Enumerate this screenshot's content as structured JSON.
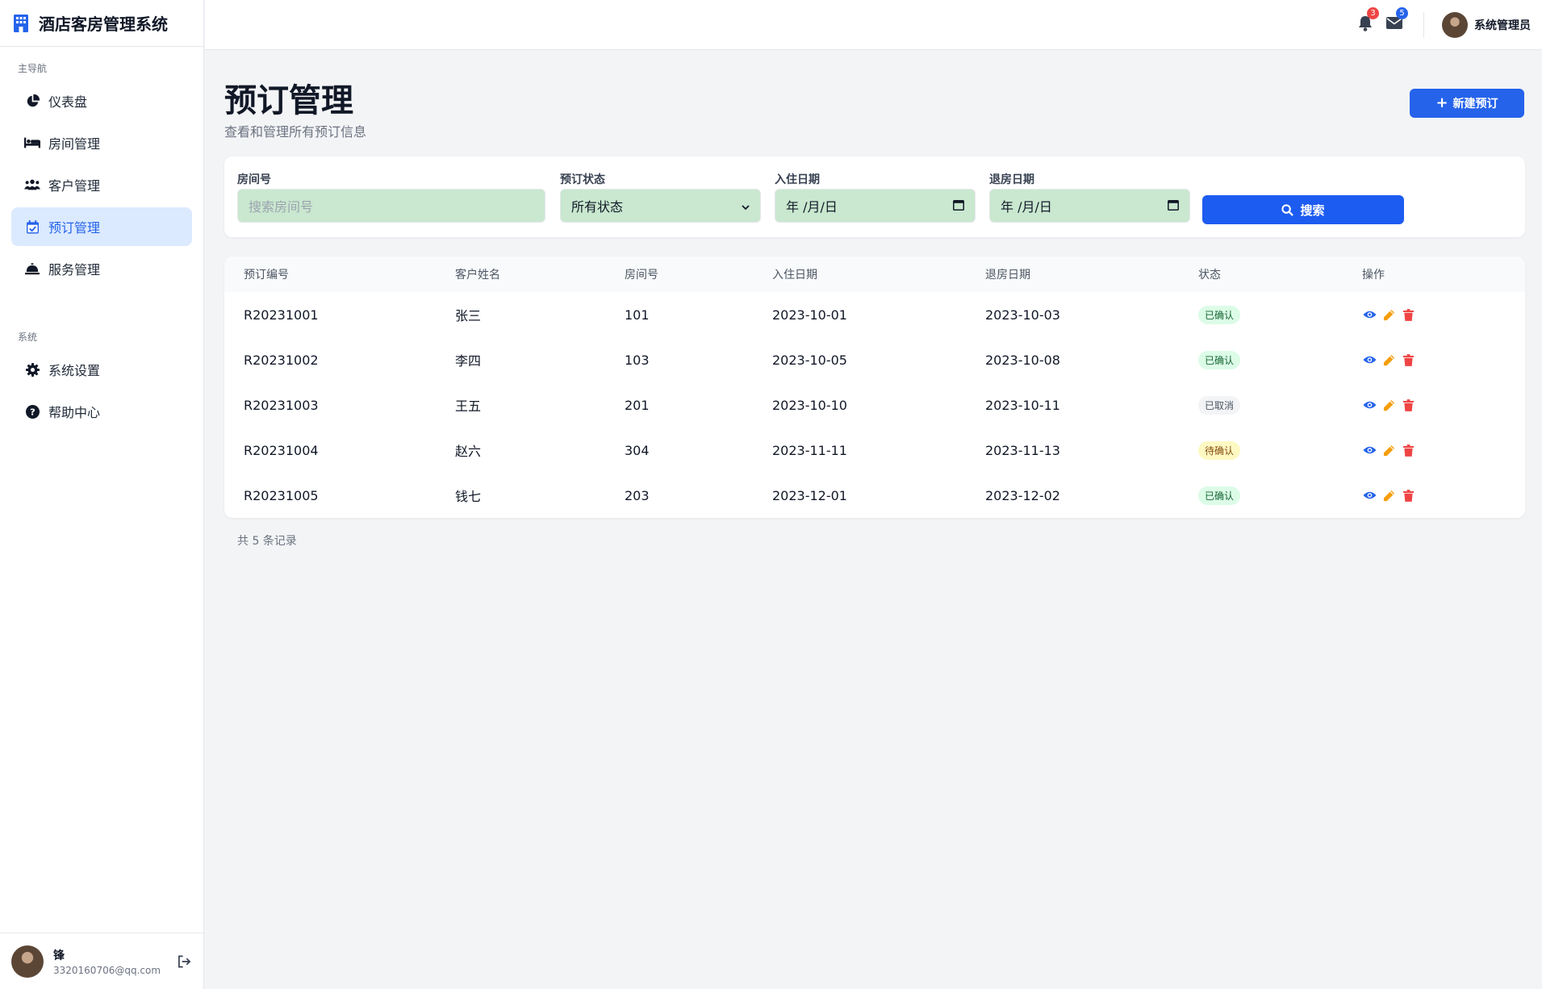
{
  "brand": {
    "title": "酒店客房管理系统"
  },
  "sidebar": {
    "main_section": "主导航",
    "main_items": [
      {
        "label": "仪表盘",
        "icon": "chart-pie-icon"
      },
      {
        "label": "房间管理",
        "icon": "bed-icon"
      },
      {
        "label": "客户管理",
        "icon": "users-icon"
      },
      {
        "label": "预订管理",
        "icon": "calendar-check-icon",
        "active": true
      },
      {
        "label": "服务管理",
        "icon": "bell-concierge-icon"
      }
    ],
    "system_section": "系统",
    "system_items": [
      {
        "label": "系统设置",
        "icon": "gear-icon"
      },
      {
        "label": "帮助中心",
        "icon": "question-circle-icon"
      }
    ],
    "footer": {
      "name": "锋",
      "email": "3320160706@qq.com"
    }
  },
  "header": {
    "notifications_count": "3",
    "messages_count": "5",
    "user_name": "系统管理员"
  },
  "page": {
    "title": "预订管理",
    "subtitle": "查看和管理所有预订信息",
    "new_button": "新建预订"
  },
  "filters": {
    "room_label": "房间号",
    "room_placeholder": "搜索房间号",
    "status_label": "预订状态",
    "status_value": "所有状态",
    "checkin_label": "入住日期",
    "checkin_value": "年 /月/日",
    "checkout_label": "退房日期",
    "checkout_value": "年 /月/日",
    "search_button": "搜索"
  },
  "table": {
    "headers": [
      "预订编号",
      "客户姓名",
      "房间号",
      "入住日期",
      "退房日期",
      "状态",
      "操作"
    ],
    "rows": [
      {
        "id": "R20231001",
        "name": "张三",
        "room": "101",
        "checkin": "2023-10-01",
        "checkout": "2023-10-03",
        "status": "已确认"
      },
      {
        "id": "R20231002",
        "name": "李四",
        "room": "103",
        "checkin": "2023-10-05",
        "checkout": "2023-10-08",
        "status": "已确认"
      },
      {
        "id": "R20231003",
        "name": "王五",
        "room": "201",
        "checkin": "2023-10-10",
        "checkout": "2023-10-11",
        "status": "已取消"
      },
      {
        "id": "R20231004",
        "name": "赵六",
        "room": "304",
        "checkin": "2023-11-11",
        "checkout": "2023-11-13",
        "status": "待确认"
      },
      {
        "id": "R20231005",
        "name": "钱七",
        "room": "203",
        "checkin": "2023-12-01",
        "checkout": "2023-12-02",
        "status": "已确认"
      }
    ]
  },
  "footer_text": "共 5 条记录",
  "colors": {
    "primary": "#2563eb",
    "danger": "#ef4444",
    "warning": "#f59e0b",
    "input_bg": "#c9e8cf"
  }
}
